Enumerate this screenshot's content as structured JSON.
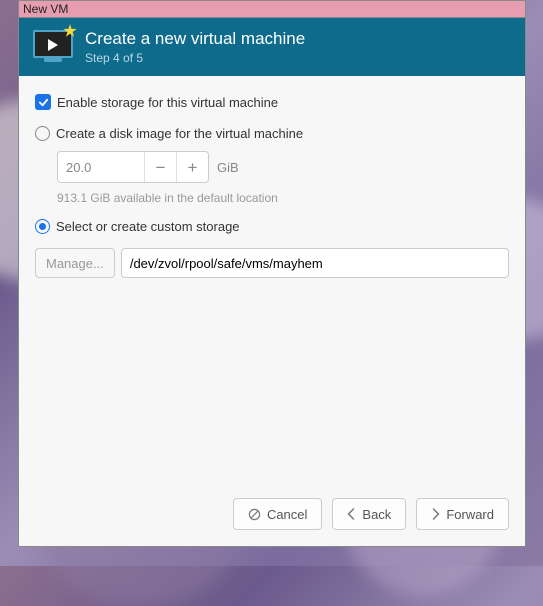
{
  "window": {
    "title": "New VM"
  },
  "header": {
    "title": "Create a new virtual machine",
    "step": "Step 4 of 5"
  },
  "storage": {
    "enable_label": "Enable storage for this virtual machine",
    "enable_checked": true,
    "create_disk_label": "Create a disk image for the virtual machine",
    "create_disk_selected": false,
    "size_value": "20.0",
    "size_unit": "GiB",
    "available_text": "913.1 GiB available in the default location",
    "custom_label": "Select or create custom storage",
    "custom_selected": true,
    "manage_label": "Manage...",
    "path_value": "/dev/zvol/rpool/safe/vms/mayhem"
  },
  "footer": {
    "cancel": "Cancel",
    "back": "Back",
    "forward": "Forward"
  }
}
